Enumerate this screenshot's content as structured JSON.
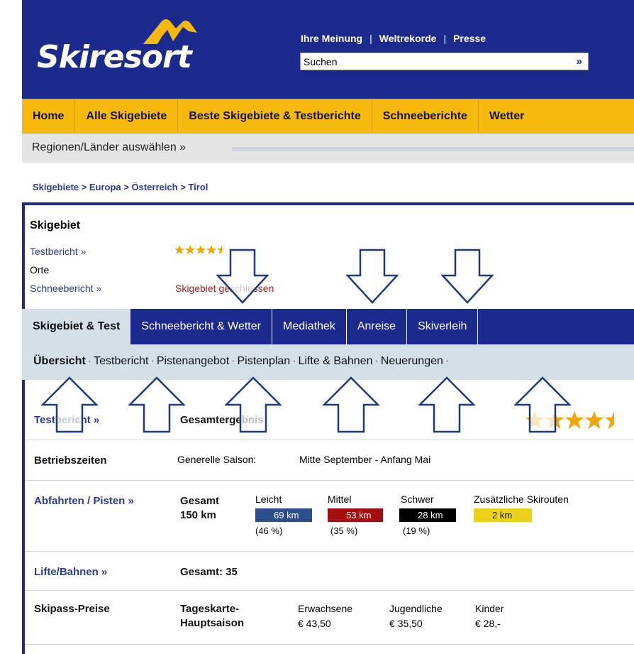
{
  "header": {
    "logo_text": "Skiresort",
    "links": [
      "Ihre Meinung",
      "Weltrekorde",
      "Presse"
    ],
    "search_value": "Suchen",
    "search_go": "»"
  },
  "main_nav": [
    "Home",
    "Alle Skigebiete",
    "Beste Skigebiete & Testberichte",
    "Schneeberichte",
    "Wetter"
  ],
  "region_bar": {
    "label": "Regionen/Länder auswählen »"
  },
  "breadcrumb": [
    "Skigebiete",
    "Europa",
    "Österreich",
    "Tirol"
  ],
  "breadcrumb_sep": ">",
  "overview": {
    "heading": "Skigebiet",
    "testbericht_link": "Testbericht »",
    "orte_label": "Orte",
    "schneebericht_link": "Schneebericht »",
    "status_text": "Skigebiet geschlossen",
    "rating_stars": 4.5
  },
  "tabs": [
    "Skigebiet & Test",
    "Schneebericht & Wetter",
    "Mediathek",
    "Anreise",
    "Skiverleih"
  ],
  "subtabs": [
    "Übersicht",
    "Testbericht",
    "Pistenangebot",
    "Pistenplan",
    "Lifte & Bahnen",
    "Neuerungen"
  ],
  "subtab_sep": "·",
  "rows": {
    "test": {
      "link": "Testbericht »",
      "label": "Gesamtergebnis"
    },
    "betriebszeiten": {
      "label": "Betriebszeiten",
      "season_label": "Generelle Saison:",
      "season_value": "Mitte September - Anfang Mai"
    },
    "pisten": {
      "link": "Abfahrten / Pisten »",
      "total_label": "Gesamt",
      "total_value": "150 km",
      "categories": [
        {
          "name": "Leicht",
          "km": "69 km",
          "pct": "(46 %)",
          "color": "#2c4f8a"
        },
        {
          "name": "Mittel",
          "km": "53 km",
          "pct": "(35 %)",
          "color": "#a30f0f"
        },
        {
          "name": "Schwer",
          "km": "28 km",
          "pct": "(19 %)",
          "color": "#000000"
        },
        {
          "name": "Zusätzliche Skirouten",
          "km": "2 km",
          "pct": "",
          "color": "#ecd11b"
        }
      ]
    },
    "lifte": {
      "link": "Lifte/Bahnen »",
      "total": "Gesamt: 35"
    },
    "skipass": {
      "label": "Skipass-Preise",
      "ticket_line1": "Tageskarte-",
      "ticket_line2": "Hauptsaison",
      "prices": [
        {
          "name": "Erwachsene",
          "value": "€ 43,50"
        },
        {
          "name": "Jugendliche",
          "value": "€ 35,50"
        },
        {
          "name": "Kinder",
          "value": "€ 28,-"
        }
      ]
    }
  },
  "colors": {
    "header_blue": "#1b2a8c",
    "nav_yellow": "#f8b90e",
    "subtab_bg": "#d4dfe8",
    "link_blue": "#2a3c8e",
    "star_gold": "#f1a50a"
  }
}
